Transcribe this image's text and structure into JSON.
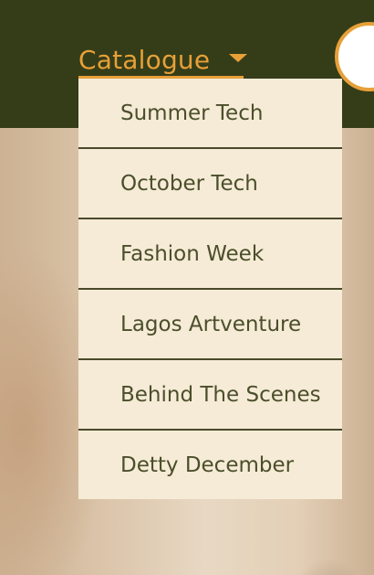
{
  "header": {
    "nav_label": "Catalogue",
    "accent_color": "#e7a038",
    "background_color": "#353d18"
  },
  "dropdown": {
    "items": [
      {
        "label": "Summer Tech"
      },
      {
        "label": "October Tech"
      },
      {
        "label": "Fashion Week"
      },
      {
        "label": "Lagos Artventure"
      },
      {
        "label": "Behind The Scenes"
      },
      {
        "label": "Detty December"
      }
    ],
    "background_color": "#f5ebd6",
    "text_color": "#4b4e2b"
  }
}
